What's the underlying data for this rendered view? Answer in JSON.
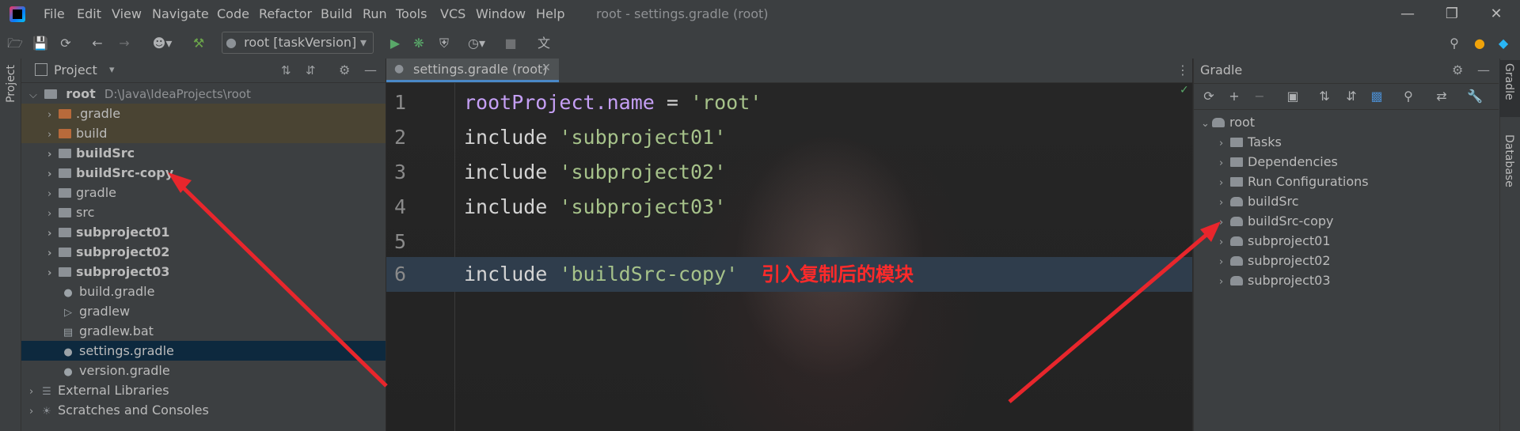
{
  "window": {
    "title": "root - settings.gradle (root)",
    "menu": [
      "File",
      "Edit",
      "View",
      "Navigate",
      "Code",
      "Refactor",
      "Build",
      "Run",
      "Tools",
      "VCS",
      "Window",
      "Help"
    ]
  },
  "toolbar": {
    "run_config": "root [taskVersion]"
  },
  "left_stripe": {
    "project_label": "Project"
  },
  "project_panel": {
    "title": "Project",
    "root_name": "root",
    "root_path": "D:\\Java\\IdeaProjects\\root",
    "items": [
      {
        "label": ".gradle"
      },
      {
        "label": "build"
      },
      {
        "label": "buildSrc"
      },
      {
        "label": "buildSrc-copy"
      },
      {
        "label": "gradle"
      },
      {
        "label": "src"
      },
      {
        "label": "subproject01"
      },
      {
        "label": "subproject02"
      },
      {
        "label": "subproject03"
      },
      {
        "label": "build.gradle"
      },
      {
        "label": "gradlew"
      },
      {
        "label": "gradlew.bat"
      },
      {
        "label": "settings.gradle"
      },
      {
        "label": "version.gradle"
      },
      {
        "label": "External Libraries"
      },
      {
        "label": "Scratches and Consoles"
      }
    ]
  },
  "editor": {
    "tab_label": "settings.gradle (root)",
    "lines": [
      {
        "num": "1",
        "kw": "rootProject.name",
        "op": " = ",
        "str": "'root'"
      },
      {
        "num": "2",
        "kw": "include ",
        "str": "'subproject01'"
      },
      {
        "num": "3",
        "kw": "include ",
        "str": "'subproject02'"
      },
      {
        "num": "4",
        "kw": "include ",
        "str": "'subproject03'"
      },
      {
        "num": "5"
      },
      {
        "num": "6",
        "kw": "include ",
        "str": "'buildSrc-copy'"
      }
    ],
    "annotation": "引入复制后的模块"
  },
  "gradle_panel": {
    "title": "Gradle",
    "root": "root",
    "items": [
      {
        "label": "Tasks"
      },
      {
        "label": "Dependencies"
      },
      {
        "label": "Run Configurations"
      },
      {
        "label": "buildSrc"
      },
      {
        "label": "buildSrc-copy"
      },
      {
        "label": "subproject01"
      },
      {
        "label": "subproject02"
      },
      {
        "label": "subproject03"
      }
    ]
  },
  "right_stripe": {
    "gradle_label": "Gradle",
    "database_label": "Database"
  },
  "colors": {
    "accent": "#2f3d4c",
    "annotation": "#ff2a2a"
  }
}
